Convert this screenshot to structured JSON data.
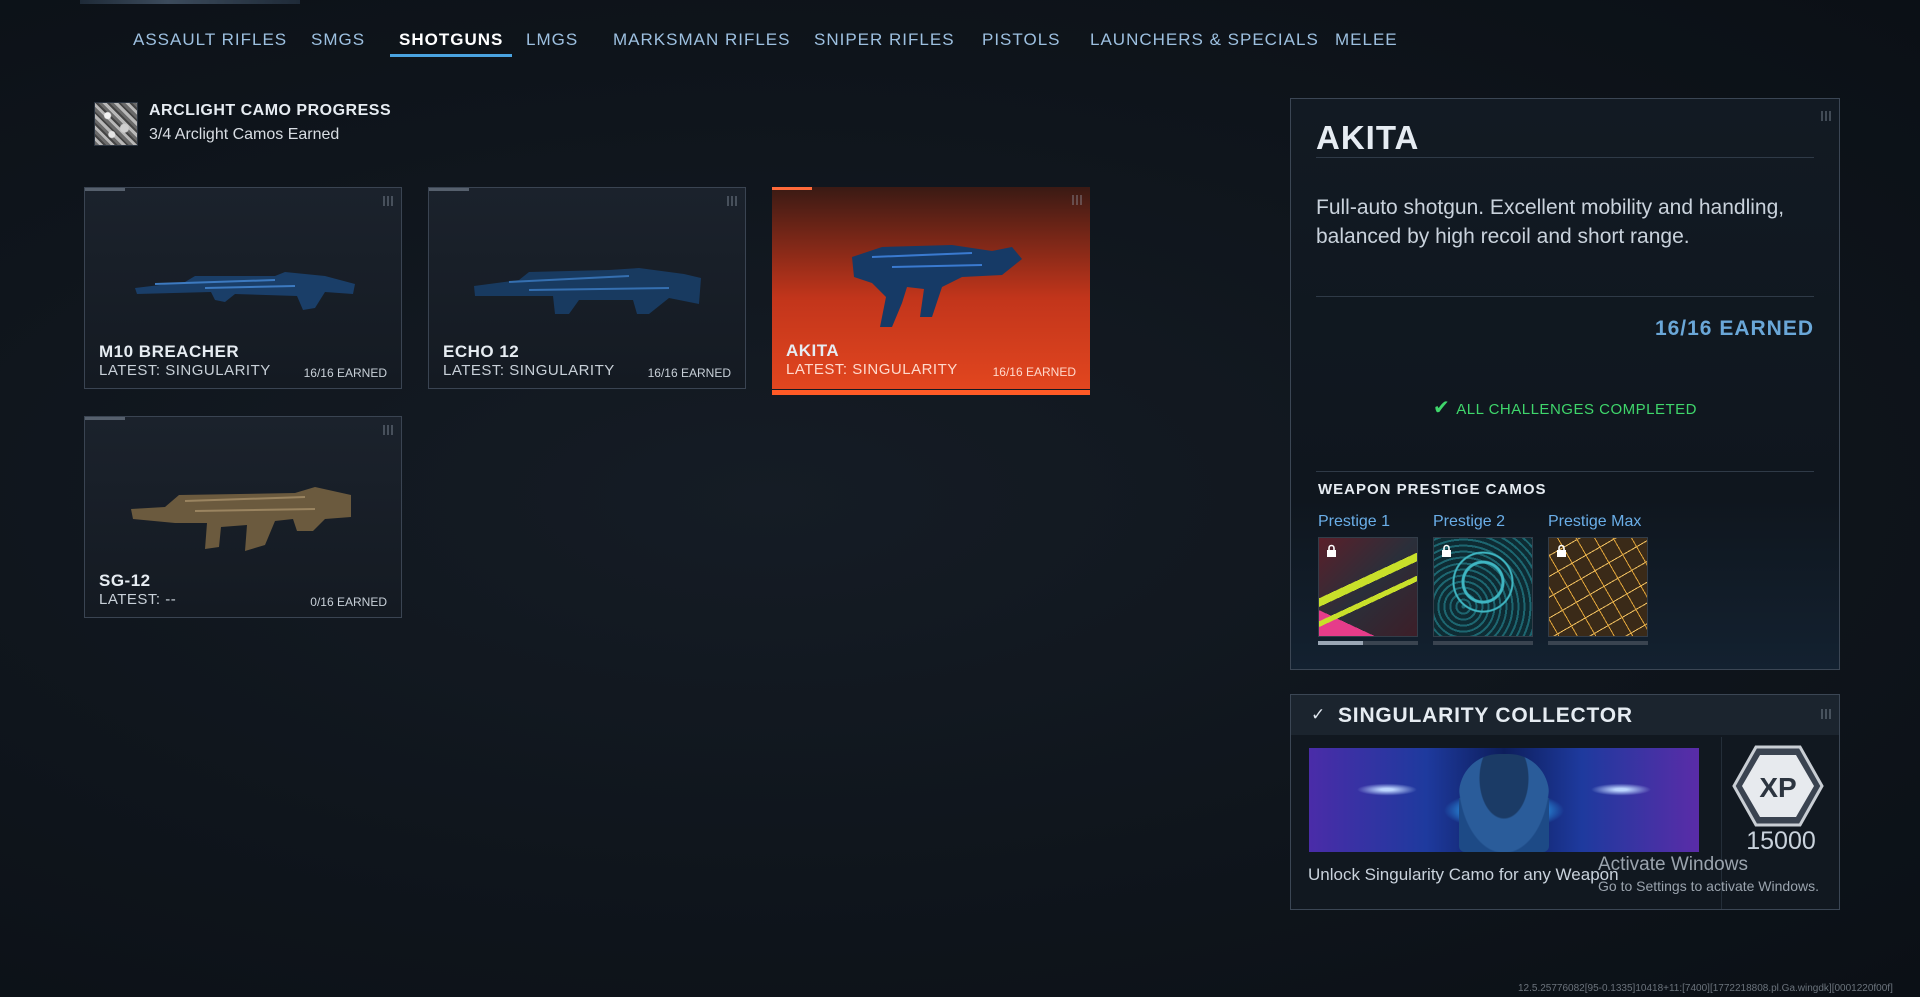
{
  "tabs": [
    {
      "label": "ASSAULT RIFLES"
    },
    {
      "label": "SMGS"
    },
    {
      "label": "SHOTGUNS",
      "active": true
    },
    {
      "label": "LMGS"
    },
    {
      "label": "MARKSMAN RIFLES"
    },
    {
      "label": "SNIPER RIFLES"
    },
    {
      "label": "PISTOLS"
    },
    {
      "label": "LAUNCHERS & SPECIALS"
    },
    {
      "label": "MELEE"
    }
  ],
  "arclight": {
    "title": "ARCLIGHT CAMO PROGRESS",
    "subtitle": "3/4 Arclight Camos Earned"
  },
  "weapons": [
    {
      "name": "M10 BREACHER",
      "latest": "LATEST: SINGULARITY",
      "earned": "16/16 EARNED",
      "selected": false,
      "icon": "shotgun-camo-blue"
    },
    {
      "name": "ECHO 12",
      "latest": "LATEST: SINGULARITY",
      "earned": "16/16 EARNED",
      "selected": false,
      "icon": "shotgun-camo-blue"
    },
    {
      "name": "AKITA",
      "latest": "LATEST: SINGULARITY",
      "earned": "16/16 EARNED",
      "selected": true,
      "icon": "shotgun-camo-blue"
    },
    {
      "name": "SG-12",
      "latest": "LATEST: --",
      "earned": "0/16 EARNED",
      "selected": false,
      "icon": "shotgun-tan"
    }
  ],
  "detail": {
    "title": "AKITA",
    "description": "Full-auto shotgun. Excellent mobility and handling, balanced by high recoil and short range.",
    "earned": "16/16 EARNED",
    "status": "ALL CHALLENGES COMPLETED",
    "prestige_heading": "WEAPON PRESTIGE CAMOS",
    "prestige": [
      {
        "label": "Prestige 1",
        "locked": true
      },
      {
        "label": "Prestige 2",
        "locked": true
      },
      {
        "label": "Prestige Max",
        "locked": true
      }
    ]
  },
  "collector": {
    "title": "SINGULARITY COLLECTOR",
    "description": "Unlock Singularity Camo for any Weapon",
    "xp_label": "XP",
    "xp_value": "15000"
  },
  "watermark": {
    "title": "Activate Windows",
    "subtitle": "Go to Settings to activate Windows."
  },
  "build_string": "12.5.25776082[95-0.1335]10418+11:[7400][1772218808.pl.Ga.wingdk][0001220f00f]",
  "colors": {
    "accent_blue": "#4aa3e0",
    "selected_orange": "#e2461f",
    "complete_green": "#3fd66b",
    "earned_blue": "#6aa7d8"
  }
}
